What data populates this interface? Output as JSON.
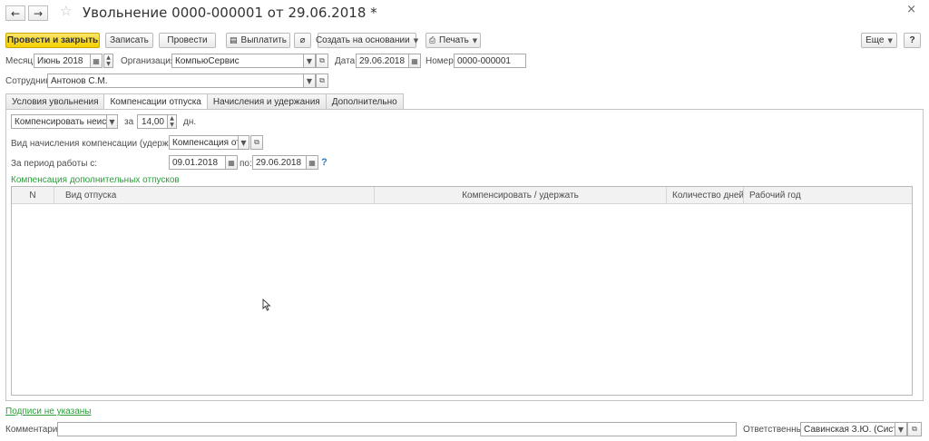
{
  "window": {
    "title": "Увольнение 0000-000001 от 29.06.2018 *",
    "back_icon": "←",
    "forward_icon": "→",
    "star_icon": "☆",
    "close_icon": "×"
  },
  "toolbar": {
    "post_close": "Провести и закрыть",
    "save": "Записать",
    "post": "Провести",
    "pay": "Выплатить",
    "create_based": "Создать на основании",
    "print": "Печать",
    "more": "Еще",
    "help": "?"
  },
  "header": {
    "month_label": "Месяц:",
    "month_value": "Июнь 2018",
    "org_label": "Организация:",
    "org_value": "КомпьюСервис",
    "date_label": "Дата:",
    "date_value": "29.06.2018",
    "number_label": "Номер:",
    "number_value": "0000-000001",
    "employee_label": "Сотрудник:",
    "employee_value": "Антонов С.М."
  },
  "tabs": [
    {
      "label": "Условия увольнения",
      "active": false
    },
    {
      "label": "Компенсации отпуска",
      "active": true
    },
    {
      "label": "Начисления и удержания",
      "active": false
    },
    {
      "label": "Дополнительно",
      "active": false
    }
  ],
  "compensation": {
    "mode_value": "Компенсировать неиспол",
    "for_label": "за",
    "days_value": "14,00",
    "days_unit": "дн.",
    "accrual_label": "Вид начисления компенсации (удержания):",
    "accrual_value": "Компенсация отпу",
    "period_label": "За период работы с:",
    "period_from": "09.01.2018",
    "period_to_label": "по:",
    "period_to": "29.06.2018",
    "help": "?",
    "additional_title": "Компенсация дополнительных отпусков"
  },
  "table": {
    "columns": [
      "N",
      "Вид отпуска",
      "Компенсировать / удержать",
      "Количество дней",
      "Рабочий год"
    ],
    "rows": []
  },
  "footer": {
    "signatures_link": "Подписи не указаны",
    "comment_label": "Комментарий:",
    "comment_value": "",
    "responsible_label": "Ответственный:",
    "responsible_value": "Савинская З.Ю. (Систем"
  }
}
